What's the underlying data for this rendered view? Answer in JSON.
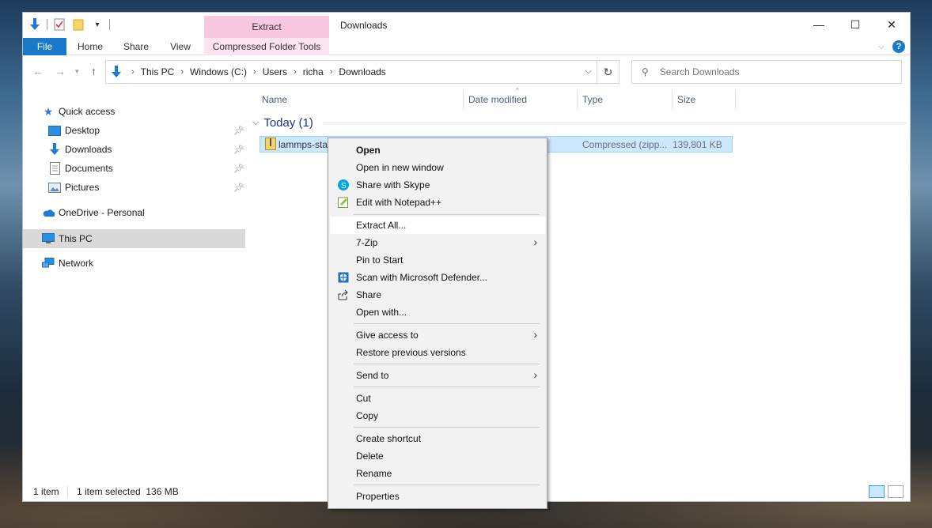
{
  "titlebar": {
    "context_tab_header": "Extract",
    "window_title": "Downloads",
    "minimize": "—",
    "maximize": "☐",
    "close": "✕"
  },
  "ribbon": {
    "tabs": [
      "File",
      "Home",
      "Share",
      "View"
    ],
    "context_tab": "Compressed Folder Tools",
    "help": "?"
  },
  "address": {
    "crumbs": [
      "This PC",
      "Windows (C:)",
      "Users",
      "richa",
      "Downloads"
    ]
  },
  "search": {
    "placeholder": "Search Downloads"
  },
  "nav": {
    "quick_access": "Quick access",
    "desktop": "Desktop",
    "downloads": "Downloads",
    "documents": "Documents",
    "pictures": "Pictures",
    "onedrive": "OneDrive - Personal",
    "this_pc": "This PC",
    "network": "Network"
  },
  "columns": {
    "name": "Name",
    "date": "Date modified",
    "type": "Type",
    "size": "Size"
  },
  "group": {
    "label": "Today (1)"
  },
  "file": {
    "name": "lammps-sta",
    "type": "Compressed (zipp...",
    "size": "139,801 KB"
  },
  "status": {
    "count": "1 item",
    "selected": "1 item selected  136 MB"
  },
  "menu": {
    "open": "Open",
    "open_new_window": "Open in new window",
    "share_skype": "Share with Skype",
    "edit_notepad": "Edit with Notepad++",
    "extract_all": "Extract All...",
    "seven_zip": "7-Zip",
    "pin_start": "Pin to Start",
    "scan_defender": "Scan with Microsoft Defender...",
    "share": "Share",
    "open_with": "Open with...",
    "give_access": "Give access to",
    "restore_versions": "Restore previous versions",
    "send_to": "Send to",
    "cut": "Cut",
    "copy": "Copy",
    "create_shortcut": "Create shortcut",
    "delete": "Delete",
    "rename": "Rename",
    "properties": "Properties"
  },
  "colors": {
    "accent": "#1979ca",
    "selection": "#cce8ff",
    "context_tab": "#f7c8e0"
  }
}
